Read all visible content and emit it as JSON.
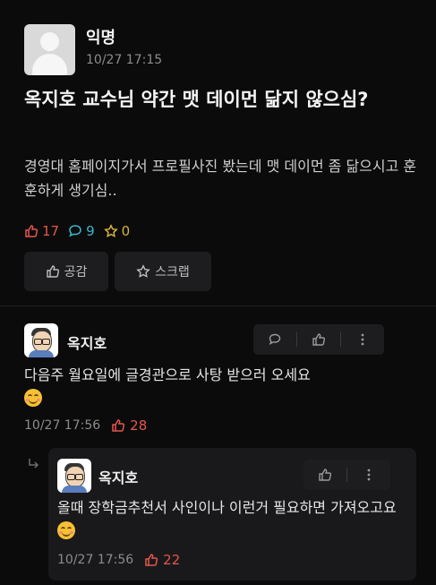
{
  "post": {
    "author": "익명",
    "time": "10/27 17:15",
    "title": "옥지호 교수님 약간 맷 데이먼 닮지 않으심?",
    "body": "경영대 홈페이지가서 프로필사진 봤는데 맷 데이먼 좀 닮으시고 훈훈하게 생기심..",
    "likes": "17",
    "comments": "9",
    "scraps": "0",
    "empathy_label": "공감",
    "scrap_label": "스크랩"
  },
  "comments": [
    {
      "author": "옥지호",
      "text": "다음주 월요일에 글경관으로 사탕 받으러 오세요",
      "emoji": "smiling-face",
      "time": "10/27 17:56",
      "likes": "28"
    }
  ],
  "reply": {
    "author": "옥지호",
    "text": "올때 장학금추천서 사인이나 이런거 필요하면 가져오고요",
    "emoji": "blushing-smile-face",
    "time": "10/27 17:56",
    "likes": "22"
  },
  "colors": {
    "background": "#0b0b0c",
    "like": "#e4574c",
    "comment": "#3bb6c9",
    "scrap": "#d7b23a"
  }
}
